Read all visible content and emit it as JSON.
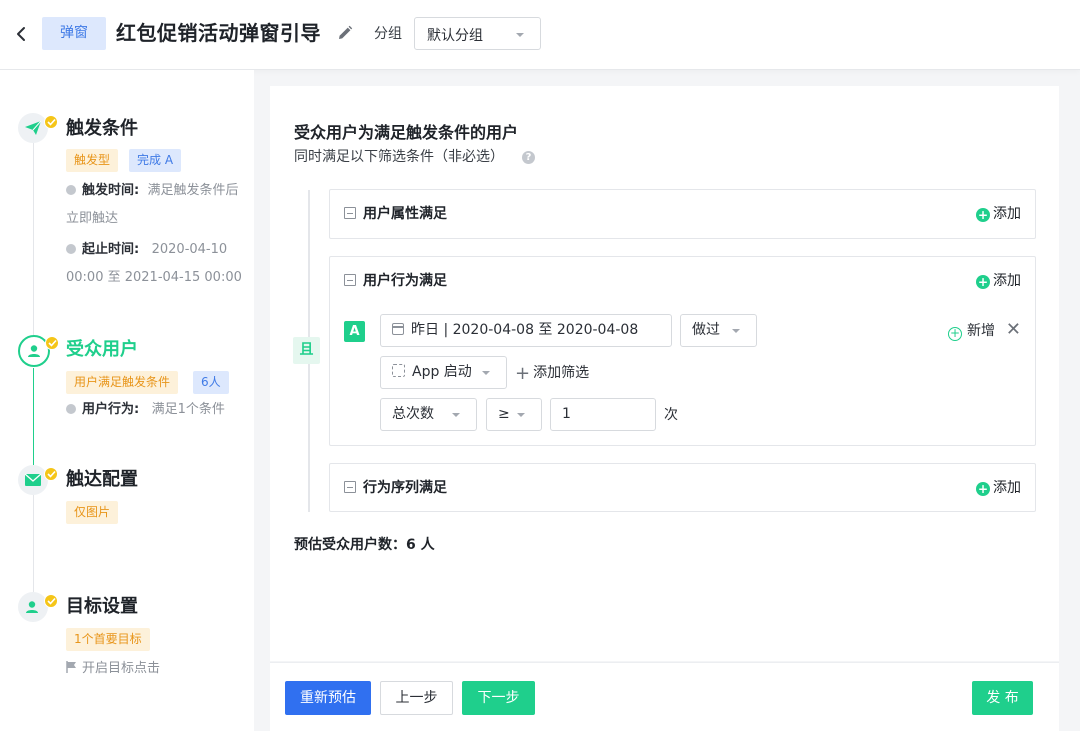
{
  "header": {
    "type_tag": "弹窗",
    "title": "红包促销活动弹窗引导",
    "group_label": "分组",
    "group_value": "默认分组"
  },
  "steps": {
    "trigger": {
      "title": "触发条件",
      "tags": [
        "触发型",
        "完成 A"
      ],
      "trigger_time_key": "触发时间:",
      "trigger_time_val": "满足触发条件后立即触达",
      "range_key": "起止时间:",
      "range_line1": "2020-04-10",
      "range_line2": "00:00 至 2021-04-15 00:00"
    },
    "audience": {
      "title": "受众用户",
      "tags": [
        "用户满足触发条件",
        "6人"
      ],
      "behavior_key": "用户行为:",
      "behavior_val": "满足1个条件"
    },
    "reach": {
      "title": "触达配置",
      "tags": [
        "仅图片"
      ]
    },
    "goal": {
      "title": "目标设置",
      "tags": [
        "1个首要目标"
      ],
      "link": "开启目标点击"
    }
  },
  "main": {
    "title": "受众用户为满足触发条件的用户",
    "subtitle": "同时满足以下筛选条件（非必选）",
    "help": "?",
    "and_label": "且",
    "groups": {
      "attr": {
        "title": "用户属性满足",
        "add": "添加"
      },
      "behavior": {
        "title": "用户行为满足",
        "add": "添加"
      },
      "sequence": {
        "title": "行为序列满足",
        "add": "添加"
      }
    },
    "condition": {
      "badge": "A",
      "date_range": "昨日 | 2020-04-08 至 2020-04-08",
      "action": "做过",
      "event": "App 启动",
      "add_filter": "添加筛选",
      "metric": "总次数",
      "operator": "≥",
      "value": "1",
      "unit": "次",
      "new": "新增",
      "close": "✕"
    },
    "estimate": "预估受众用户数：6 人"
  },
  "footer": {
    "re_estimate": "重新预估",
    "prev": "上一步",
    "next": "下一步",
    "publish": "发 布"
  },
  "colors": {
    "accent_green": "#1fcf8c",
    "accent_blue": "#3070f0",
    "tag_orange": "#e8951a",
    "check_yellow": "#f5c518"
  }
}
